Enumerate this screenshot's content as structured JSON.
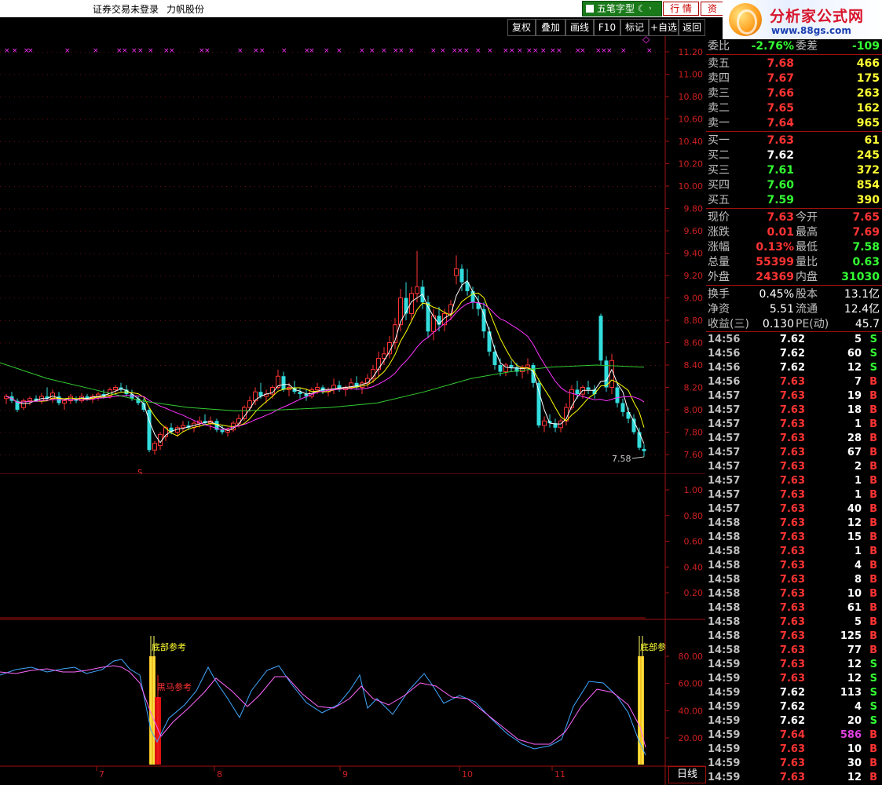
{
  "topbar": {
    "login_status": "证券交易未登录",
    "stock_name": "力帆股份",
    "style_label": "五笔字型",
    "tab_quote": "行 情",
    "tab_info": "资",
    "logo_text": "分析家公式网",
    "logo_url_text": "www.88gs.com"
  },
  "toolbar": [
    "复权",
    "叠加",
    "画线",
    "F10",
    "标记",
    "+自选",
    "返回"
  ],
  "main_chart": {
    "y_ticks": [
      "11.20",
      "11.00",
      "10.80",
      "10.60",
      "10.40",
      "10.20",
      "10.00",
      "9.80",
      "9.60",
      "9.40",
      "9.20",
      "9.00",
      "8.80",
      "8.60",
      "8.40",
      "8.20",
      "8.00",
      "7.80",
      "7.60"
    ],
    "last_label": "7.58",
    "marker": "S"
  },
  "volume_chart": {
    "y_ticks": [
      "1.00",
      "0.80",
      "0.60",
      "0.40",
      "0.20"
    ]
  },
  "indicator_chart": {
    "y_ticks": [
      "80.00",
      "60.00",
      "40.00",
      "20.00"
    ],
    "labels": [
      "底部参考",
      "黑马参考",
      "底部参"
    ],
    "x_ticks": [
      "7",
      "8",
      "9",
      "10",
      "11"
    ]
  },
  "day_button": "日线",
  "colors": {
    "up": "#ff3333",
    "down": "#33dddd",
    "ma5": "#ffffff",
    "ma10": "#ffff00",
    "ma20": "#ff33ff",
    "ma60": "#33cc33"
  },
  "panel": {
    "committee": {
      "label": "委比",
      "value": "-2.76%",
      "label2": "委差",
      "value2": "-109"
    },
    "asks": [
      {
        "label": "卖五",
        "price": "7.68",
        "vol": "466"
      },
      {
        "label": "卖四",
        "price": "7.67",
        "vol": "175"
      },
      {
        "label": "卖三",
        "price": "7.66",
        "vol": "263"
      },
      {
        "label": "卖二",
        "price": "7.65",
        "vol": "162"
      },
      {
        "label": "卖一",
        "price": "7.64",
        "vol": "965"
      }
    ],
    "bids": [
      {
        "label": "买一",
        "price": "7.63",
        "vol": "61",
        "color": "red"
      },
      {
        "label": "买二",
        "price": "7.62",
        "vol": "245",
        "color": "white"
      },
      {
        "label": "买三",
        "price": "7.61",
        "vol": "372",
        "color": "green"
      },
      {
        "label": "买四",
        "price": "7.60",
        "vol": "854",
        "color": "green"
      },
      {
        "label": "买五",
        "price": "7.59",
        "vol": "390",
        "color": "green"
      }
    ],
    "quote": [
      {
        "l1": "现价",
        "v1": "7.63",
        "c1": "red",
        "l2": "今开",
        "v2": "7.65",
        "c2": "red"
      },
      {
        "l1": "涨跌",
        "v1": "0.01",
        "c1": "red",
        "l2": "最高",
        "v2": "7.69",
        "c2": "red"
      },
      {
        "l1": "涨幅",
        "v1": "0.13%",
        "c1": "red",
        "l2": "最低",
        "v2": "7.58",
        "c2": "green"
      },
      {
        "l1": "总量",
        "v1": "55399",
        "c1": "red",
        "l2": "量比",
        "v2": "0.63",
        "c2": "green"
      },
      {
        "l1": "外盘",
        "v1": "24369",
        "c1": "red",
        "l2": "内盘",
        "v2": "31030",
        "c2": "green"
      }
    ],
    "finance": [
      {
        "l1": "换手",
        "v1": "0.45%",
        "l2": "股本",
        "v2": "13.1亿"
      },
      {
        "l1": "净资",
        "v1": "5.51",
        "l2": "流通",
        "v2": "12.4亿"
      },
      {
        "l1": "收益(三)",
        "v1": "0.130",
        "l2": "PE(动)",
        "v2": "45.7"
      }
    ],
    "ticks": [
      {
        "t": "14:56",
        "p": "7.62",
        "v": "5",
        "s": "S",
        "pc": "white",
        "vc": "white",
        "sc": "green"
      },
      {
        "t": "14:56",
        "p": "7.62",
        "v": "60",
        "s": "S",
        "pc": "white",
        "vc": "white",
        "sc": "green"
      },
      {
        "t": "14:56",
        "p": "7.62",
        "v": "12",
        "s": "S",
        "pc": "white",
        "vc": "white",
        "sc": "green"
      },
      {
        "t": "14:56",
        "p": "7.63",
        "v": "7",
        "s": "B",
        "pc": "red",
        "vc": "white",
        "sc": "red"
      },
      {
        "t": "14:57",
        "p": "7.63",
        "v": "19",
        "s": "B",
        "pc": "red",
        "vc": "white",
        "sc": "red"
      },
      {
        "t": "14:57",
        "p": "7.63",
        "v": "18",
        "s": "B",
        "pc": "red",
        "vc": "white",
        "sc": "red"
      },
      {
        "t": "14:57",
        "p": "7.63",
        "v": "1",
        "s": "B",
        "pc": "red",
        "vc": "white",
        "sc": "red"
      },
      {
        "t": "14:57",
        "p": "7.63",
        "v": "28",
        "s": "B",
        "pc": "red",
        "vc": "white",
        "sc": "red"
      },
      {
        "t": "14:57",
        "p": "7.63",
        "v": "67",
        "s": "B",
        "pc": "red",
        "vc": "white",
        "sc": "red"
      },
      {
        "t": "14:57",
        "p": "7.63",
        "v": "2",
        "s": "B",
        "pc": "red",
        "vc": "white",
        "sc": "red"
      },
      {
        "t": "14:57",
        "p": "7.63",
        "v": "1",
        "s": "B",
        "pc": "red",
        "vc": "white",
        "sc": "red"
      },
      {
        "t": "14:57",
        "p": "7.63",
        "v": "1",
        "s": "B",
        "pc": "red",
        "vc": "white",
        "sc": "red"
      },
      {
        "t": "14:57",
        "p": "7.63",
        "v": "40",
        "s": "B",
        "pc": "red",
        "vc": "white",
        "sc": "red"
      },
      {
        "t": "14:58",
        "p": "7.63",
        "v": "12",
        "s": "B",
        "pc": "red",
        "vc": "white",
        "sc": "red"
      },
      {
        "t": "14:58",
        "p": "7.63",
        "v": "15",
        "s": "B",
        "pc": "red",
        "vc": "white",
        "sc": "red"
      },
      {
        "t": "14:58",
        "p": "7.63",
        "v": "1",
        "s": "B",
        "pc": "red",
        "vc": "white",
        "sc": "red"
      },
      {
        "t": "14:58",
        "p": "7.63",
        "v": "4",
        "s": "B",
        "pc": "red",
        "vc": "white",
        "sc": "red"
      },
      {
        "t": "14:58",
        "p": "7.63",
        "v": "8",
        "s": "B",
        "pc": "red",
        "vc": "white",
        "sc": "red"
      },
      {
        "t": "14:58",
        "p": "7.63",
        "v": "10",
        "s": "B",
        "pc": "red",
        "vc": "white",
        "sc": "red"
      },
      {
        "t": "14:58",
        "p": "7.63",
        "v": "61",
        "s": "B",
        "pc": "red",
        "vc": "white",
        "sc": "red"
      },
      {
        "t": "14:58",
        "p": "7.63",
        "v": "5",
        "s": "B",
        "pc": "red",
        "vc": "white",
        "sc": "red"
      },
      {
        "t": "14:58",
        "p": "7.63",
        "v": "125",
        "s": "B",
        "pc": "red",
        "vc": "white",
        "sc": "red"
      },
      {
        "t": "14:58",
        "p": "7.63",
        "v": "77",
        "s": "B",
        "pc": "red",
        "vc": "white",
        "sc": "red"
      },
      {
        "t": "14:59",
        "p": "7.63",
        "v": "12",
        "s": "S",
        "pc": "red",
        "vc": "white",
        "sc": "green"
      },
      {
        "t": "14:59",
        "p": "7.63",
        "v": "12",
        "s": "S",
        "pc": "red",
        "vc": "white",
        "sc": "green"
      },
      {
        "t": "14:59",
        "p": "7.62",
        "v": "113",
        "s": "S",
        "pc": "white",
        "vc": "white",
        "sc": "green"
      },
      {
        "t": "14:59",
        "p": "7.62",
        "v": "4",
        "s": "S",
        "pc": "white",
        "vc": "white",
        "sc": "green"
      },
      {
        "t": "14:59",
        "p": "7.62",
        "v": "20",
        "s": "S",
        "pc": "white",
        "vc": "white",
        "sc": "green"
      },
      {
        "t": "14:59",
        "p": "7.64",
        "v": "586",
        "s": "B",
        "pc": "red",
        "vc": "magenta",
        "sc": "red"
      },
      {
        "t": "14:59",
        "p": "7.63",
        "v": "10",
        "s": "B",
        "pc": "red",
        "vc": "white",
        "sc": "red"
      },
      {
        "t": "14:59",
        "p": "7.63",
        "v": "30",
        "s": "B",
        "pc": "red",
        "vc": "white",
        "sc": "red"
      },
      {
        "t": "14:59",
        "p": "7.63",
        "v": "12",
        "s": "B",
        "pc": "red",
        "vc": "white",
        "sc": "red"
      }
    ]
  }
}
